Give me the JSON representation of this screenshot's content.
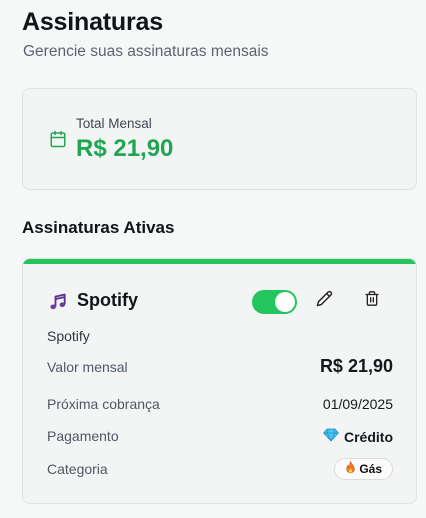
{
  "header": {
    "title": "Assinaturas",
    "subtitle": "Gerencie suas assinaturas mensais"
  },
  "total": {
    "icon": "calendar-icon",
    "label": "Total Mensal",
    "value": "R$ 21,90"
  },
  "section": {
    "title": "Assinaturas Ativas"
  },
  "subscription": {
    "icon": "music-note-icon",
    "name": "Spotify",
    "description": "Spotify",
    "active": true,
    "rows": {
      "valor_label": "Valor mensal",
      "valor_value": "R$ 21,90",
      "proxima_label": "Próxima cobrança",
      "proxima_value": "01/09/2025",
      "pagamento_label": "Pagamento",
      "pagamento_value": "Crédito",
      "pagamento_icon": "diamond-icon",
      "categoria_label": "Categoria",
      "categoria_value": "Gás",
      "categoria_icon": "fire-icon"
    }
  },
  "colors": {
    "accent": "#22c55e",
    "total_value": "#21a553"
  }
}
